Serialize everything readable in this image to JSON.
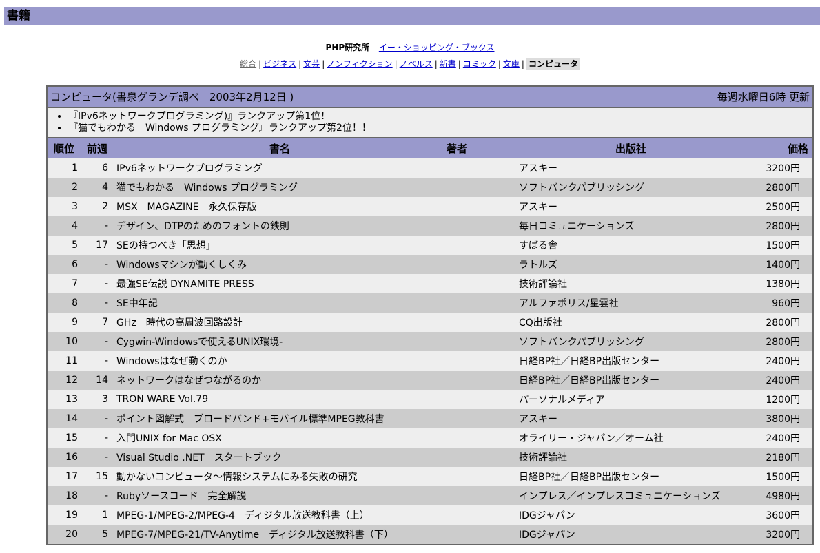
{
  "page_title": "書籍",
  "publisher": {
    "name": "PHP研究所",
    "dash": " – ",
    "link": "イー・ショッピング・ブックス"
  },
  "nav": [
    {
      "label": "総合",
      "state": "visited"
    },
    {
      "label": "ビジネス"
    },
    {
      "label": "文芸"
    },
    {
      "label": "ノンフィクション"
    },
    {
      "label": "ノベルス"
    },
    {
      "label": "新書"
    },
    {
      "label": "コミック"
    },
    {
      "label": "文庫"
    },
    {
      "label": "コンピュータ",
      "state": "current"
    }
  ],
  "section": {
    "title": "コンピュータ(書泉グランデ調べ　2003年2月12日 )",
    "update": "毎週水曜日6時 更新"
  },
  "notes": [
    "『IPv6ネットワークプログラミング)』ランクアップ第1位！",
    "『猫でもわかる　Windows プログラミング』ランクアップ第2位！！"
  ],
  "columns": [
    "順位",
    "前週",
    "書名",
    "著者",
    "出版社",
    "価格"
  ],
  "rows": [
    [
      "1",
      "6",
      "IPv6ネットワークプログラミング",
      "",
      "アスキー",
      "3200円"
    ],
    [
      "2",
      "4",
      "猫でもわかる　Windows プログラミング",
      "",
      "ソフトバンクパブリッシング",
      "2800円"
    ],
    [
      "3",
      "2",
      "MSX　MAGAZINE　永久保存版",
      "",
      "アスキー",
      "2500円"
    ],
    [
      "4",
      "-",
      "デザイン、DTPのためのフォントの鉄則",
      "",
      "毎日コミュニケーションズ",
      "2800円"
    ],
    [
      "5",
      "17",
      "SEの持つべき「思想」",
      "",
      "すばる舎",
      "1500円"
    ],
    [
      "6",
      "-",
      "Windowsマシンが動くしくみ",
      "",
      "ラトルズ",
      "1400円"
    ],
    [
      "7",
      "-",
      "最強SE伝説 DYNAMITE PRESS",
      "",
      "技術評論社",
      "1380円"
    ],
    [
      "8",
      "-",
      "SE中年記",
      "",
      "アルファポリス/星雲社",
      "960円"
    ],
    [
      "9",
      "7",
      "GHz　時代の高周波回路設計",
      "",
      "CQ出版社",
      "2800円"
    ],
    [
      "10",
      "-",
      "Cygwin-Windowsで使えるUNIX環境-",
      "",
      "ソフトバンクパブリッシング",
      "2800円"
    ],
    [
      "11",
      "-",
      "Windowsはなぜ動くのか",
      "",
      "日経BP社／日経BP出版センター",
      "2400円"
    ],
    [
      "12",
      "14",
      "ネットワークはなぜつながるのか",
      "",
      "日経BP社／日経BP出版センター",
      "2400円"
    ],
    [
      "13",
      "3",
      "TRON WARE Vol.79",
      "",
      "パーソナルメディア",
      "1200円"
    ],
    [
      "14",
      "-",
      "ポイント図解式　ブロードバンド+モバイル標準MPEG教科書",
      "",
      "アスキー",
      "3800円"
    ],
    [
      "15",
      "-",
      "入門UNIX for Mac OSX",
      "",
      "オライリー・ジャパン／オーム社",
      "2400円"
    ],
    [
      "16",
      "-",
      "Visual Studio .NET　スタートブック",
      "",
      "技術評論社",
      "2180円"
    ],
    [
      "17",
      "15",
      "動かないコンピュータ～情報システムにみる失敗の研究",
      "",
      "日経BP社／日経BP出版センター",
      "1500円"
    ],
    [
      "18",
      "-",
      "Rubyソースコード　完全解説",
      "",
      "インプレス／インプレスコミュニケーションズ",
      "4980円"
    ],
    [
      "19",
      "1",
      "MPEG-1/MPEG-2/MPEG-4　ディジタル放送教科書（上）",
      "",
      "IDGジャパン",
      "3600円"
    ],
    [
      "20",
      "5",
      "MPEG-7/MPEG-21/TV-Anytime　ディジタル放送教科書（下）",
      "",
      "IDGジャパン",
      "3200円"
    ]
  ]
}
